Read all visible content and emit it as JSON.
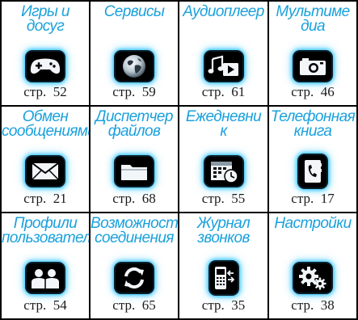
{
  "menu": {
    "items": [
      {
        "title": "Игры и досуг",
        "page": "стр.  52",
        "icon": "gamepad-icon"
      },
      {
        "title": "Сервисы",
        "page": "стр.  59",
        "icon": "globe-icon"
      },
      {
        "title": "Аудиоплеер",
        "page": "стр.  61",
        "icon": "music-player-icon"
      },
      {
        "title": "Мультиме\nдиа",
        "page": "стр.  46",
        "icon": "camera-icon"
      },
      {
        "title": "Обмен\nсообщениями",
        "page": "стр.  21",
        "icon": "envelope-icon"
      },
      {
        "title": "Диспетчер\nфайлов",
        "page": "стр.  68",
        "icon": "folder-icon"
      },
      {
        "title": "Ежедневни\nк",
        "page": "стр.  55",
        "icon": "calendar-clock-icon"
      },
      {
        "title": "Телефонная\nкнига",
        "page": "стр.  17",
        "icon": "phonebook-icon"
      },
      {
        "title": "Профили\nпользователя",
        "page": "стр.  54",
        "icon": "profiles-icon"
      },
      {
        "title": "Возможности\nсоединения",
        "page": "стр.  65",
        "icon": "sync-icon"
      },
      {
        "title": "Журнал\nзвонков",
        "page": "стр.  35",
        "icon": "call-log-icon"
      },
      {
        "title": "Настройки",
        "page": "стр.  38",
        "icon": "gears-icon"
      }
    ]
  },
  "colors": {
    "title": "#1aa1dc",
    "border": "#000000",
    "icon_glow": "#2ec4ff"
  }
}
